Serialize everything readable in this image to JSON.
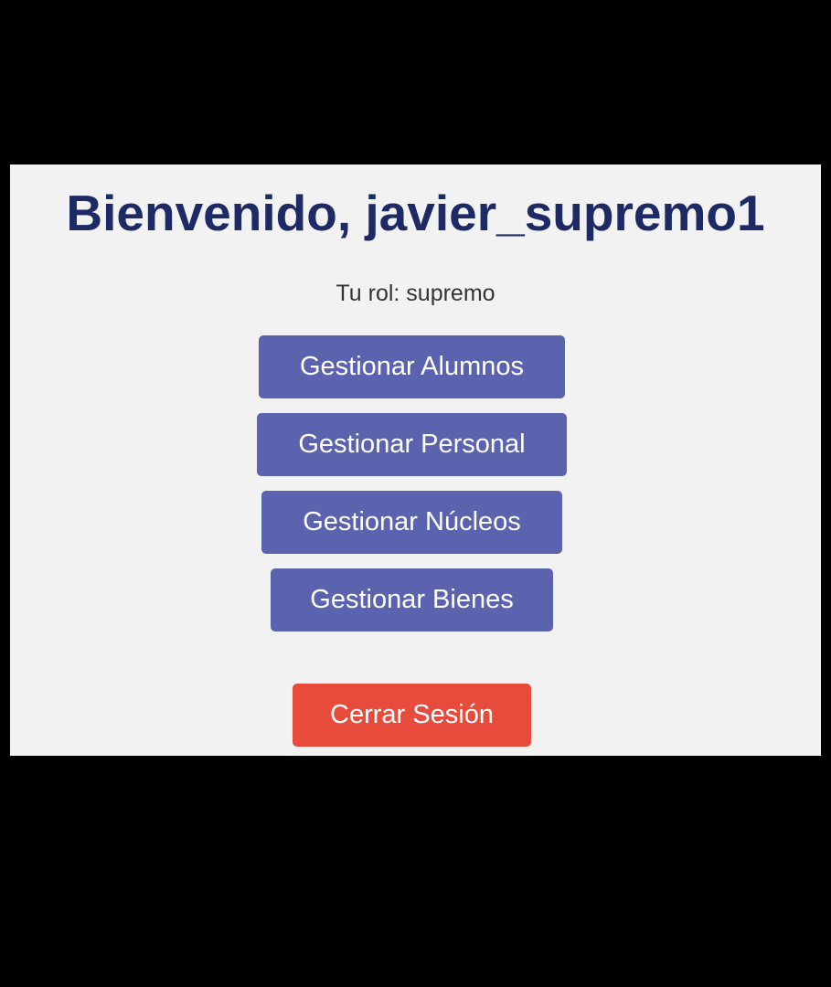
{
  "header": {
    "title": "Bienvenido, javier_supremo1",
    "role_text": "Tu rol: supremo"
  },
  "menu": {
    "items": [
      {
        "label": "Gestionar Alumnos"
      },
      {
        "label": "Gestionar Personal"
      },
      {
        "label": "Gestionar Núcleos"
      },
      {
        "label": "Gestionar Bienes"
      }
    ]
  },
  "logout": {
    "label": "Cerrar Sesión"
  },
  "colors": {
    "title": "#1e2a66",
    "nav_button": "#5b63af",
    "logout_button": "#e64b3c",
    "panel_background": "#f2f2f3",
    "outer_background": "#000000"
  }
}
